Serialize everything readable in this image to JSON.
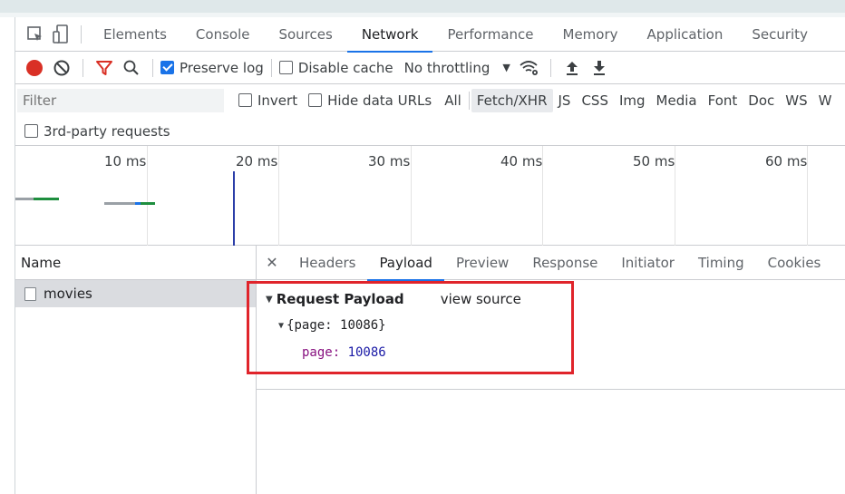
{
  "devtools": {
    "tabs": [
      "Elements",
      "Console",
      "Sources",
      "Network",
      "Performance",
      "Memory",
      "Application",
      "Security"
    ],
    "active_tab": "Network"
  },
  "toolbar": {
    "preserve_log": "Preserve log",
    "disable_cache": "Disable cache",
    "throttling": "No throttling"
  },
  "filterbar": {
    "placeholder": "Filter",
    "invert": "Invert",
    "hide_data_urls": "Hide data URLs",
    "types": [
      "All",
      "Fetch/XHR",
      "JS",
      "CSS",
      "Img",
      "Media",
      "Font",
      "Doc",
      "WS",
      "W"
    ],
    "selected_type": "Fetch/XHR",
    "third_party": "3rd-party requests"
  },
  "timeline": {
    "ticks": [
      "10 ms",
      "20 ms",
      "30 ms",
      "40 ms",
      "50 ms",
      "60 ms"
    ]
  },
  "requests": {
    "header": "Name",
    "items": [
      {
        "name": "movies"
      }
    ]
  },
  "detail": {
    "tabs": [
      "Headers",
      "Payload",
      "Preview",
      "Response",
      "Initiator",
      "Timing",
      "Cookies"
    ],
    "active_tab": "Payload",
    "section_title": "Request Payload",
    "view_source": "view source",
    "object_summary": "{page: 10086}",
    "fields": [
      {
        "key": "page",
        "value": "10086"
      }
    ]
  },
  "colors": {
    "accent": "#1a73e8",
    "record": "#d93025",
    "highlight_box": "#e0242b"
  }
}
